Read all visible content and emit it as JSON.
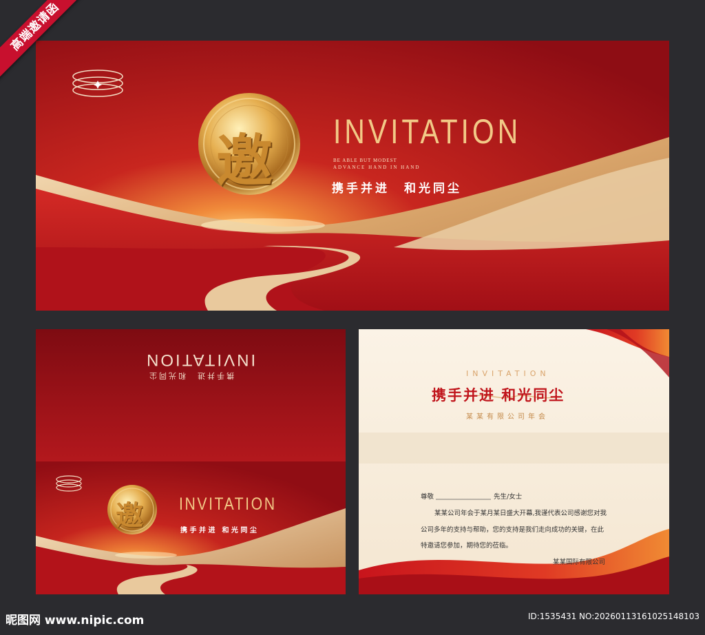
{
  "ribbon_label": "高端邀请函",
  "main_card": {
    "seal_char": "邀",
    "title": "INVITATION",
    "subtitle_line1": "BE ABLE BUT MODEST",
    "subtitle_line2": "ADVANCE HAND IN HAND",
    "slogan": "携手并进　和光同尘"
  },
  "cover_card": {
    "mirrored_title": "INVITATION",
    "mirrored_slogan": "携手并进　和光同尘",
    "seal_char": "邀",
    "title": "INVITATION",
    "slogan": "携 手 并 进　和 光 同 尘"
  },
  "letter_card": {
    "header": "INVITATION",
    "slogan": "携手并进 和光同尘",
    "company_event": "某某有限公司年会",
    "salutation": "尊敬",
    "title_suffix": "先生/女士",
    "paragraph_line1": "某某公司年会于某月某日盛大开幕,我谨代表公司感谢您对我",
    "paragraph_line2": "公司多年的支持与帮助，您的支持是我们走向成功的关键，在此",
    "paragraph_line3": "特邀请您参加，期待您的莅临。",
    "signature": "某某国际有限公司"
  },
  "footer": {
    "site": "昵图网 www.nipic.com",
    "id_text": "ID:1535431 NO:20260113161025148103"
  },
  "colors": {
    "background": "#2b2b2f",
    "brand_red": "#b3121e",
    "gold": "#e3b46a",
    "cream": "#faf1e3"
  }
}
